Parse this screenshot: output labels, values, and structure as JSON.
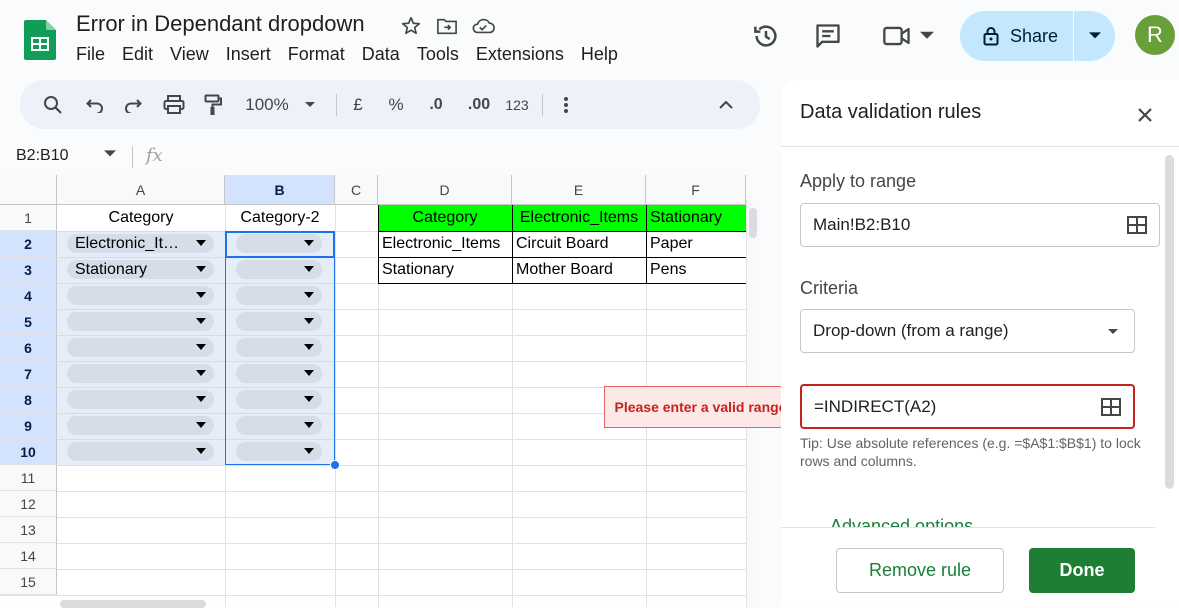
{
  "header": {
    "doc_title": "Error in Dependant dropdown",
    "menu": [
      "File",
      "Edit",
      "View",
      "Insert",
      "Format",
      "Data",
      "Tools",
      "Extensions",
      "Help"
    ],
    "share_label": "Share",
    "avatar_letter": "R"
  },
  "toolbar": {
    "zoom": "100%",
    "currency": "£",
    "percent": "%",
    "dec_decrease": ".0",
    "dec_increase": ".00",
    "format_number": "123"
  },
  "formula_bar": {
    "name_box": "B2:B10",
    "fx": "fx"
  },
  "sheet": {
    "columns": [
      "A",
      "B",
      "C",
      "D",
      "E",
      "F"
    ],
    "rows": [
      "1",
      "2",
      "3",
      "4",
      "5",
      "6",
      "7",
      "8",
      "9",
      "10",
      "11",
      "12",
      "13",
      "14",
      "15"
    ],
    "a1": "Category",
    "b1": "Category-2",
    "a2": "Electronic_It…",
    "a3": "Stationary",
    "lookup_header": [
      "Category",
      "Electronic_Items",
      "Stationary"
    ],
    "lookup_rows": [
      [
        "Electronic_Items",
        "Circuit Board",
        "Paper"
      ],
      [
        "Stationary",
        "Mother Board",
        "Pens"
      ]
    ],
    "header_fill": "#00ff00"
  },
  "panel": {
    "title": "Data validation rules",
    "apply_label": "Apply to range",
    "apply_value": "Main!B2:B10",
    "criteria_label": "Criteria",
    "criteria_value": "Drop-down (from a range)",
    "range_value": "=INDIRECT(A2)",
    "error_message": "Please enter a valid range",
    "tip": "Tip: Use absolute references (e.g. =$A$1:$B$1) to lock rows and columns.",
    "advanced_label": "Advanced options",
    "remove_label": "Remove rule",
    "done_label": "Done"
  },
  "colors": {
    "accent": "#1a73e8",
    "share_bg": "#c2e7ff",
    "done_bg": "#1e7e34",
    "error": "#c5221f"
  }
}
